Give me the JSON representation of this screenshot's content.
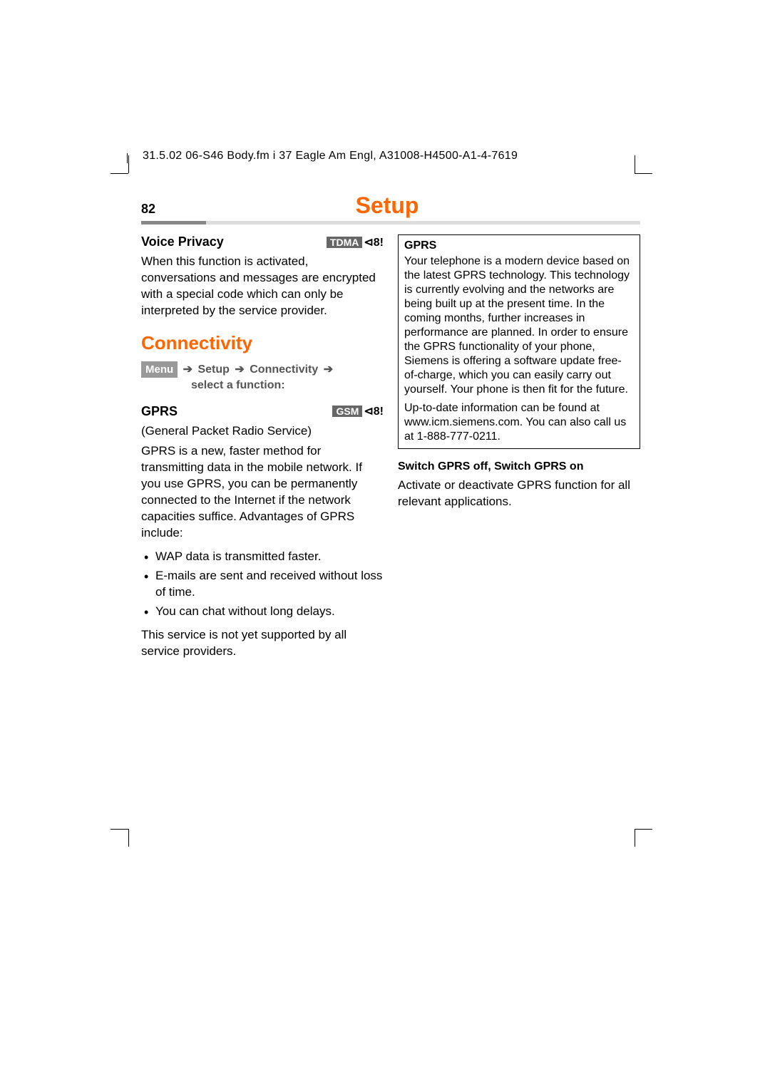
{
  "header": "31.5.02    06-S46 Body.fm    i 37 Eagle Am Engl, A31008-H4500-A1-4-7619",
  "page_num": "82",
  "chapter_title": "Setup",
  "left_col": {
    "voice_privacy": {
      "heading": "Voice Privacy",
      "badge": "TDMA",
      "body": "When this function is activated, conversations and messages are encrypted with a special code which can only be interpreted by the service provider."
    },
    "connectivity": {
      "heading": "Connectivity",
      "menu_label": "Menu",
      "nav1": "Setup",
      "nav2": "Connectivity",
      "nav3": "select a function:"
    },
    "gprs": {
      "heading": "GPRS",
      "badge": "GSM",
      "expansion": "(General Packet Radio Service)",
      "body1": "GPRS is a new, faster method for transmitting data in the mobile network. If you use GPRS, you can be permanently connected to the Internet if the network capacities suffice. Advantages of GPRS include:",
      "bullets": [
        "WAP data is transmitted faster.",
        "E-mails are sent and received without loss of time.",
        "You can chat without long delays."
      ],
      "body2": "This service is not yet supported by all service providers."
    }
  },
  "right_col": {
    "box": {
      "title": "GPRS",
      "p1": "Your telephone is a modern device based on the latest GPRS technology. This technology is currently evolving and the networks are being built up at the present time. In the coming months, further increases in performance are planned. In order to ensure the GPRS functionality of your phone, Siemens is offering a software update free-of-charge, which you can easily carry out yourself. Your phone is then fit for the future.",
      "p2": "Up-to-date information can be found at www.icm.siemens.com. You can also call us at 1-888-777-0211."
    },
    "switch": {
      "heading": "Switch GPRS off, Switch GPRS on",
      "body": "Activate or deactivate GPRS function for all relevant applications."
    }
  }
}
